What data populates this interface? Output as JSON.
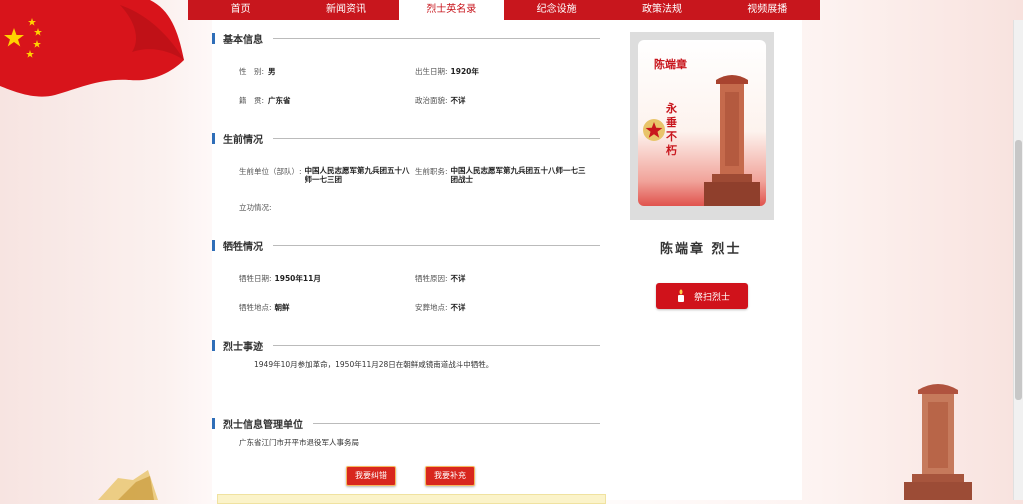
{
  "nav": {
    "items": [
      {
        "label": "首页"
      },
      {
        "label": "新闻资讯"
      },
      {
        "label": "烈士英名录"
      },
      {
        "label": "纪念设施"
      },
      {
        "label": "政策法规"
      },
      {
        "label": "视频展播"
      }
    ],
    "active_index": 2
  },
  "basic": {
    "title": "基本信息",
    "gender_label": "性　别:",
    "gender": "男",
    "birth_label": "出生日期:",
    "birth": "1920年",
    "origin_label": "籍　贯:",
    "origin": "广东省",
    "political_label": "政治面貌:",
    "political": "不详"
  },
  "life": {
    "title": "生前情况",
    "unit_label": "生前单位（部队）:",
    "unit_line1": "中国人民志愿军第九兵团五十八",
    "unit_line2": "师一七三团",
    "post_label": "生前职务:",
    "post_line1": "中国人民志愿军第九兵团五十八师一七三",
    "post_line2": "团战士",
    "merit_label": "立功情况:"
  },
  "sacrifice": {
    "title": "牺牲情况",
    "date_label": "牺牲日期:",
    "date": "1950年11月",
    "cause_label": "牺牲原因:",
    "cause": "不详",
    "place_label": "牺牲地点:",
    "place": "朝鲜",
    "burial_label": "安葬地点:",
    "burial": "不详"
  },
  "deeds": {
    "title": "烈士事迹",
    "text": "1949年10月参加革命，1950年11月28日在朝鲜咸镜南道战斗中牺牲。"
  },
  "management": {
    "title": "烈士信息管理单位",
    "org": "广东省江门市开平市退役军人事务局"
  },
  "buttons": {
    "correct": "我要纠错",
    "supplement": "我要补充"
  },
  "card": {
    "poster_name": "陈端章",
    "motto": "永垂不朽",
    "title": "陈端章 烈士",
    "sweep": "祭扫烈士"
  },
  "colors": {
    "brand_red": "#c8161d",
    "section_bar_blue": "#2f6eb8"
  },
  "icons": [
    "flag-icon",
    "candle-icon",
    "star-emblem-icon",
    "monument-icon"
  ]
}
